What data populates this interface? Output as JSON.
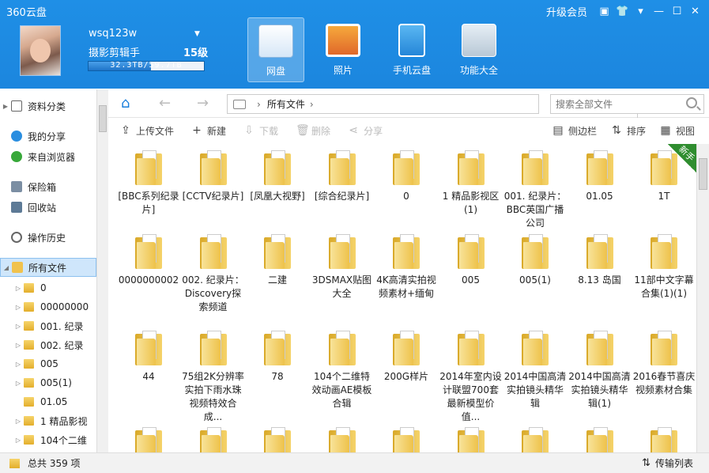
{
  "window": {
    "title": "360云盘",
    "vip": "升级会员"
  },
  "user": {
    "name": "wsq123w",
    "title": "摄影剪辑手",
    "level": "15级",
    "quota_text": "32.3TB/59.7TB",
    "quota_fraction": 0.54
  },
  "nav": [
    {
      "label": "网盘",
      "icon": "cloud-disk-icon",
      "active": true
    },
    {
      "label": "照片",
      "icon": "photo-icon",
      "active": false
    },
    {
      "label": "手机云盘",
      "icon": "mobile-cloud-icon",
      "active": false
    },
    {
      "label": "功能大全",
      "icon": "toolbox-icon",
      "active": false
    }
  ],
  "sidebar": {
    "items": [
      {
        "label": "资料分类",
        "icon": "documents-icon"
      },
      {
        "label": "我的分享",
        "icon": "share-icon"
      },
      {
        "label": "来自浏览器",
        "icon": "browser-icon"
      },
      {
        "label": "保险箱",
        "icon": "safe-icon"
      },
      {
        "label": "回收站",
        "icon": "recycle-icon"
      },
      {
        "label": "操作历史",
        "icon": "history-icon"
      }
    ],
    "root": "所有文件",
    "tree": [
      "0",
      "00000000",
      "001. 纪录",
      "002. 纪录",
      "005",
      "005(1)",
      "01.05",
      "1 精品影视",
      "104个二维"
    ]
  },
  "address": {
    "path": "所有文件",
    "search_placeholder": "搜索全部文件"
  },
  "toolbar": {
    "upload": "上传文件",
    "new": "新建",
    "download": "下载",
    "delete": "删除",
    "share": "分享",
    "sidebar": "侧边栏",
    "sort": "排序",
    "view": "视图"
  },
  "badge": "新手",
  "files": [
    "[BBC系列纪录片]",
    "[CCTV纪录片]",
    "[凤凰大视野]",
    "[综合纪录片]",
    "0",
    "1 精品影视区(1)",
    "001. 纪录片：BBC英国广播公司",
    "01.05",
    "1T",
    "0000000002",
    "002. 纪录片：Discovery探索频道",
    "二建",
    "3DSMAX贴图大全",
    "4K高清实拍视频素材+缅甸",
    "005",
    "005(1)",
    "8.13 岛国",
    "11部中文字幕合集(1)(1)",
    "44",
    "75组2K分辨率实拍下雨水珠视频特效合成...",
    "78",
    "104个二维特效动画AE模板合辑",
    "200G样片",
    "2014年室内设计联盟700套最新模型价值...",
    "2014中国高清实拍镜头精华辑",
    "2014中国高清实拍镜头精华辑(1)",
    "2016春节喜庆视频素材合集",
    "",
    "",
    "",
    "",
    "",
    "",
    "",
    "",
    ""
  ],
  "status": {
    "total": "总共 359 项",
    "transfer": "传输列表"
  }
}
